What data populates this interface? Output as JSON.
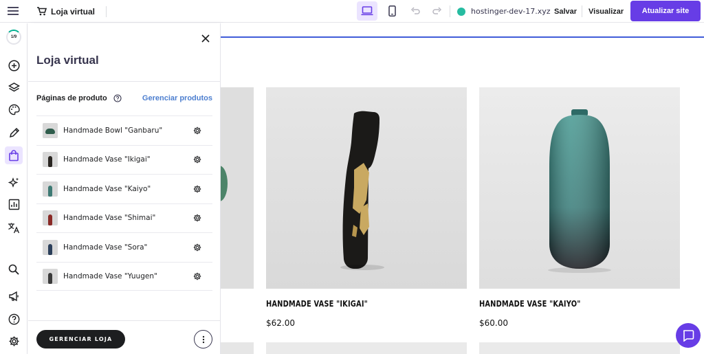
{
  "topbar": {
    "store_title": "Loja virtual",
    "domain": "hostinger-dev-17.xyz",
    "save_label": "Salvar",
    "preview_label": "Visualizar",
    "publish_label": "Atualizar site",
    "accent": "#673de6",
    "status_color": "#00b090"
  },
  "rail": {
    "progress_text": "1/9",
    "items": [
      "add-icon",
      "layers-icon",
      "palette-icon",
      "pen-icon",
      "shopping-bag-icon",
      "ai-sparkle-icon",
      "analytics-icon",
      "translate-icon",
      "search-icon",
      "megaphone-icon",
      "help-icon",
      "settings-icon"
    ]
  },
  "panel": {
    "title": "Loja virtual",
    "section_label": "Páginas de produto",
    "manage_products": "Gerenciar produtos",
    "manage_store": "GERENCIAR LOJA",
    "products": [
      {
        "name": "Handmade Bowl \"Ganbaru\"",
        "thumb_color": "#2f5d4c"
      },
      {
        "name": "Handmade Vase \"Ikigai\"",
        "thumb_color": "#2a2622"
      },
      {
        "name": "Handmade Vase \"Kaiyo\"",
        "thumb_color": "#3e7a74"
      },
      {
        "name": "Handmade Vase \"Shimai\"",
        "thumb_color": "#8a2a26"
      },
      {
        "name": "Handmade Vase \"Sora\"",
        "thumb_color": "#2b3f5a"
      },
      {
        "name": "Handmade Vase \"Yuugen\"",
        "thumb_color": "#3a3a3a"
      }
    ]
  },
  "canvas": {
    "products": [
      {
        "title": "HANDMADE VASE \"IKIGAI\"",
        "price": "$62.00"
      },
      {
        "title": "HANDMADE VASE \"KAIYO\"",
        "price": "$60.00"
      }
    ]
  }
}
